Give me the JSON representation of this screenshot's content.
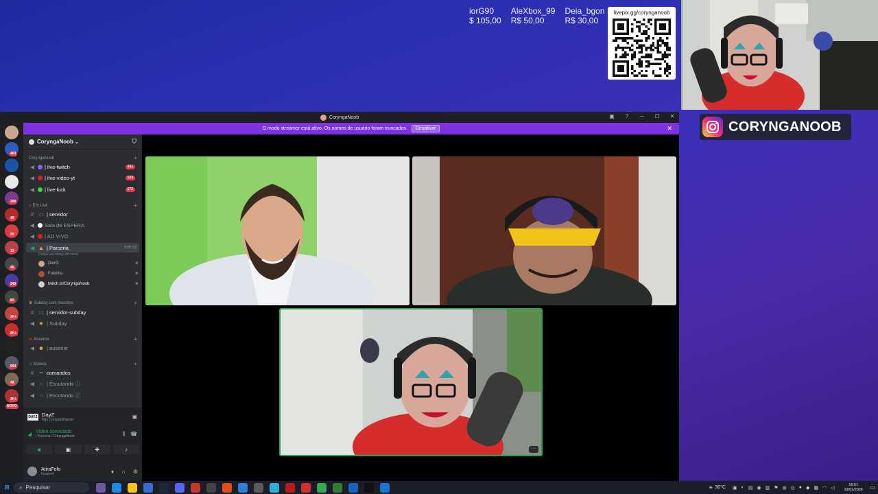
{
  "overlay": {
    "donations": [
      {
        "name": "iorG90",
        "amount": "$ 105,00"
      },
      {
        "name": "AleXbox_99",
        "amount": "R$ 50,00"
      },
      {
        "name": "Deia_bgon",
        "amount": "R$ 30,00"
      }
    ],
    "qr_url": "livepix.gg/corynganoob",
    "instagram_handle": "CORYNGANOOB"
  },
  "window": {
    "title": "CoryngaNoob",
    "banner_text": "O modo streamer está ativo. Os nomes de usuário foram truncados.",
    "banner_button": "Desativar"
  },
  "server": {
    "name": "CoryngaNoob",
    "categories": [
      {
        "label": "CoryngaNoob"
      },
      {
        "label": "Em Live"
      },
      {
        "label": "Subday com Inscritos"
      },
      {
        "label": "Ausente"
      },
      {
        "label": "Música"
      }
    ],
    "channels": [
      {
        "label": "| live-twitch",
        "badge": "411"
      },
      {
        "label": "| live-video-yt",
        "badge": "123"
      },
      {
        "label": "| live-kick",
        "badge": "172"
      },
      {
        "label": "| servidor"
      },
      {
        "label": "Sala de ESPERA"
      },
      {
        "label": "| AO VIVO"
      },
      {
        "label": "| Parceria",
        "timer": "3:05:12",
        "sub": "Definir um status do canal"
      },
      {
        "label": "| servidor-subday"
      },
      {
        "label": "| Subday"
      },
      {
        "label": "| ausente"
      },
      {
        "label": "comandos"
      },
      {
        "label": "| Escutando ⓘ"
      },
      {
        "label": "| Escutando ⓘ"
      }
    ],
    "members": [
      {
        "name": "DiorG"
      },
      {
        "name": "Fokinha"
      },
      {
        "name": "twitch.tv/CoryngaNoob"
      }
    ]
  },
  "rail_badges": [
    "463",
    "290",
    "40",
    "99",
    "13",
    "45",
    "243",
    "82",
    "2K+",
    "8K+",
    "564",
    "48",
    "3K+",
    "NOVO"
  ],
  "activity": {
    "game_logo": "DAYZ",
    "game_name": "DayZ",
    "game_sub": "Não Compartilhando",
    "voice_status": "Vídeo conectado",
    "voice_channel": "| Parceria / CoryngaNoob"
  },
  "user": {
    "name": "AtiraFofo",
    "status": "Invisível"
  },
  "taskbar": {
    "search_placeholder": "Pesquisar",
    "weather": "30°C",
    "time": "16:51",
    "date": "19/01/2026"
  },
  "colors": {
    "brand_discord": "#5865f2",
    "streamer_banner": "#7e31e0",
    "voice_green": "#23a55a",
    "badge_red": "#e8394a"
  }
}
